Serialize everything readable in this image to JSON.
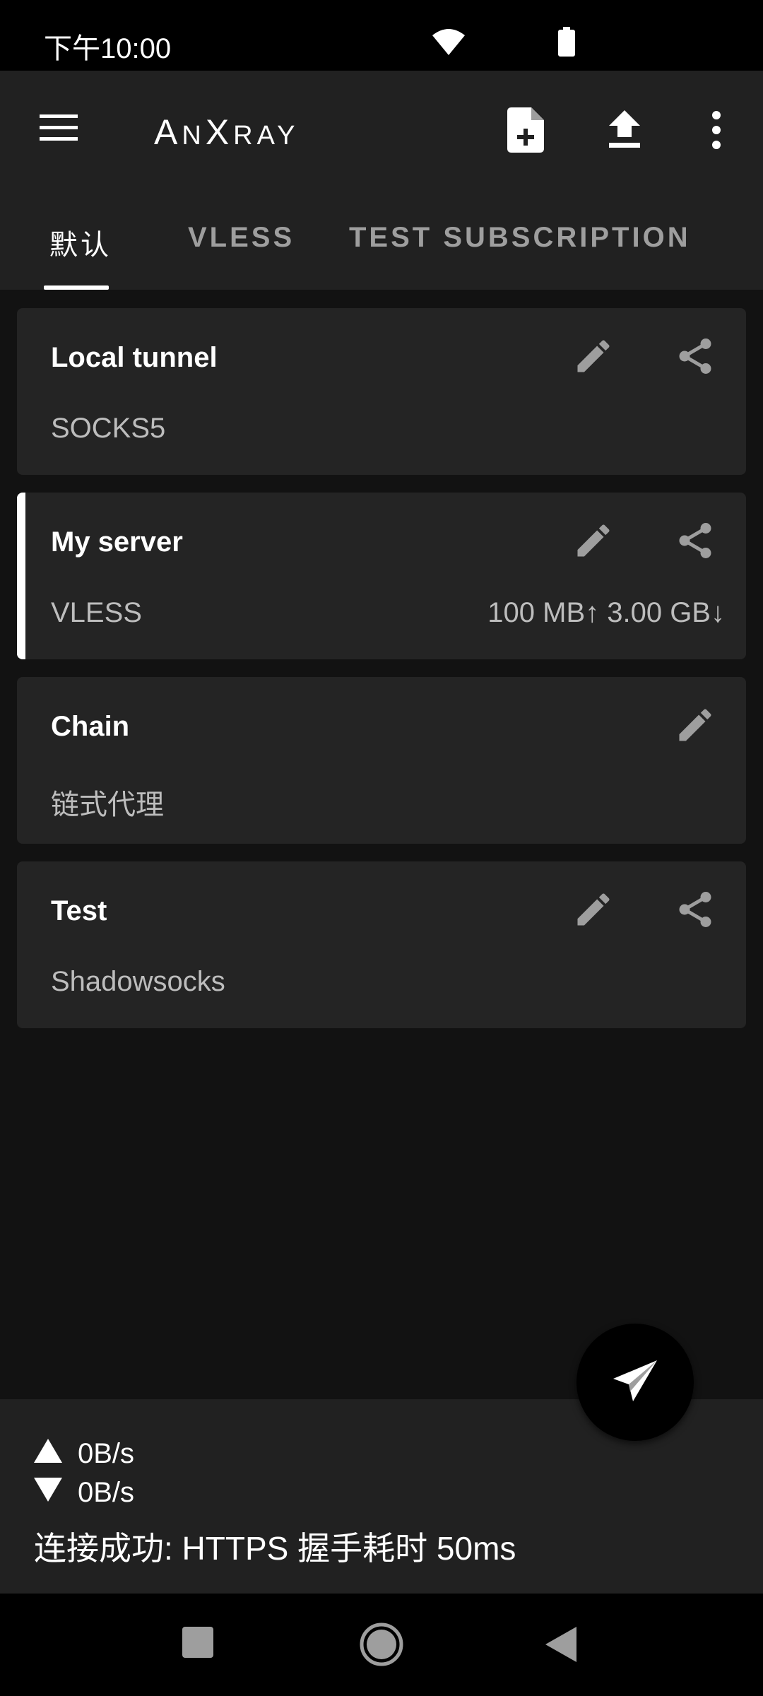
{
  "status_bar": {
    "time": "下午10:00",
    "icons": [
      "wifi-icon",
      "battery-icon"
    ]
  },
  "app_bar": {
    "title_parts": [
      "A",
      "N",
      "X",
      "RAY"
    ],
    "actions": [
      "menu-icon",
      "new-file-icon",
      "upload-icon",
      "more-vert-icon"
    ]
  },
  "tabs": [
    {
      "label": "默认"
    },
    {
      "label": "VLESS"
    },
    {
      "label": "TEST SUBSCRIPTION"
    }
  ],
  "selected_tab": 0,
  "profiles": [
    {
      "name": "Local tunnel",
      "type": "SOCKS5",
      "traffic": "",
      "selected": false
    },
    {
      "name": "My server",
      "type": "VLESS",
      "traffic": "100 MB↑ 3.00 GB↓",
      "selected": true
    },
    {
      "name": "Chain",
      "type": "链式代理",
      "traffic": "",
      "selected": false
    },
    {
      "name": "Test",
      "type": "Shadowsocks",
      "traffic": "",
      "selected": false
    }
  ],
  "stats": {
    "upload_speed": "0B/s",
    "download_speed": "0B/s",
    "status_message": "连接成功: HTTPS 握手耗时 50ms"
  },
  "fab": {
    "icon": "send-icon"
  },
  "colors": {
    "background": "#121212",
    "surface": "#242424",
    "app_bar": "#212121",
    "accent": "#ffffff",
    "text_secondary": "#bdbdbd",
    "icon": "#9e9e9e"
  }
}
